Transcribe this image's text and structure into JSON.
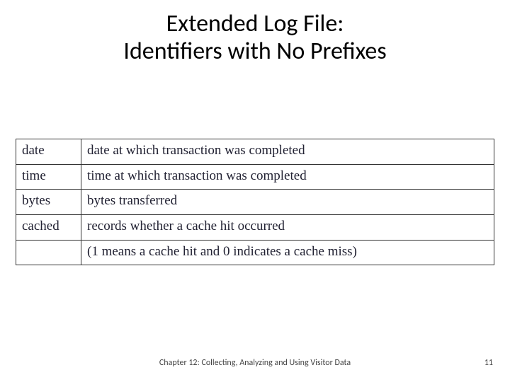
{
  "title_line1": "Extended Log File:",
  "title_line2": "Identifiers with No Prefixes",
  "rows": [
    {
      "term": "date",
      "desc": "date at which transaction was completed"
    },
    {
      "term": "time",
      "desc": "time at which transaction was completed"
    },
    {
      "term": "bytes",
      "desc": "bytes transferred"
    },
    {
      "term": "cached",
      "desc": "records whether a cache hit occurred"
    },
    {
      "term": "",
      "desc": "(1 means a cache hit and 0 indicates a cache miss)"
    }
  ],
  "footer_center": "Chapter 12: Collecting, Analyzing and Using Visitor Data",
  "page_number": "11"
}
